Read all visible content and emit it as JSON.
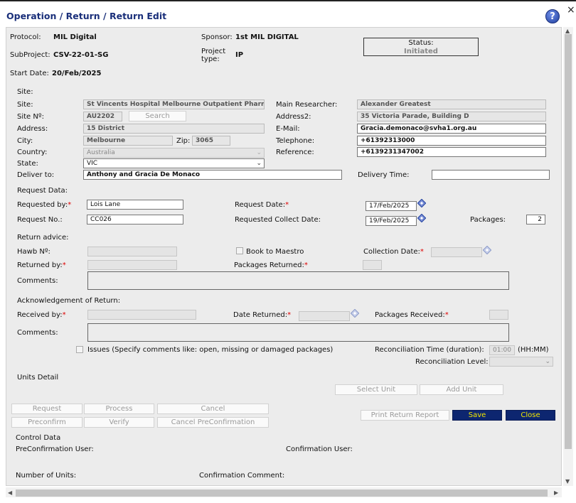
{
  "window": {
    "title": "Operation / Return / Return Edit",
    "close_glyph": "×",
    "help_glyph": "?"
  },
  "header": {
    "protocol_label": "Protocol:",
    "protocol": "MIL Digital",
    "sponsor_label": "Sponsor:",
    "sponsor": "1st MIL DIGITAL",
    "subproject_label": "SubProject:",
    "subproject": "CSV-22-01-SG",
    "project_type_label_1": "Project",
    "project_type_label_2": "type:",
    "project_type": "IP",
    "start_date_label": "Start Date:",
    "start_date": "20/Feb/2025",
    "status_label": "Status:",
    "status": "Initiated"
  },
  "site": {
    "section_label": "Site:",
    "site_label": "Site:",
    "site": "St Vincents Hospital Melbourne Outpatient Pharmacy",
    "site_no_label": "Site Nº:",
    "site_no": "AU2202",
    "search_label": "Search",
    "address_label": "Address:",
    "address": "15 District",
    "city_label": "City:",
    "city": "Melbourne",
    "zip_label": "Zip:",
    "zip": "3065",
    "country_label": "Country:",
    "country": "Australia",
    "state_label": "State:",
    "state": "VIC",
    "deliver_to_label": "Deliver to:",
    "deliver_to": "Anthony and Gracia De Monaco",
    "main_researcher_label": "Main Researcher:",
    "main_researcher": "Alexander Greatest",
    "address2_label": "Address2:",
    "address2": "35 Victoria Parade, Building D",
    "email_label": "E-Mail:",
    "email": "Gracia.demonaco@svha1.org.au",
    "telephone_label": "Telephone:",
    "telephone": "+61392313000",
    "reference_label": "Reference:",
    "reference": "+6139231347002",
    "delivery_time_label": "Delivery Time:",
    "delivery_time": ""
  },
  "request": {
    "section_label": "Request Data:",
    "requested_by_label": "Requested by:",
    "requested_by": "Lois Lane",
    "request_no_label": "Request No.:",
    "request_no": "CC026",
    "request_date_label": "Request Date:",
    "request_date": "17/Feb/2025",
    "collect_date_label": "Requested Collect Date:",
    "collect_date": "19/Feb/2025",
    "packages_label": "Packages:",
    "packages": "2"
  },
  "return_advice": {
    "section_label": "Return advice:",
    "hawb_label": "Hawb Nº:",
    "book_label": "Book to Maestro",
    "collection_date_label": "Collection Date:",
    "returned_by_label": "Returned by:",
    "packages_returned_label": "Packages Returned:",
    "comments_label": "Comments:"
  },
  "acknowledgement": {
    "section_label": "Acknowledgement of Return:",
    "received_by_label": "Received by:",
    "date_returned_label": "Date Returned:",
    "packages_received_label": "Packages Received:",
    "comments_label": "Comments:",
    "issues_label": "Issues (Specify comments like: open, missing or damaged packages)",
    "recon_time_label": "Reconciliation Time (duration):",
    "recon_time": "01:00",
    "recon_time_unit": "(HH:MM)",
    "recon_level_label": "Reconciliation Level:"
  },
  "units": {
    "section_label": "Units Detail",
    "select_unit": "Select Unit",
    "add_unit": "Add Unit"
  },
  "actions": {
    "request": "Request",
    "process": "Process",
    "cancel": "Cancel",
    "preconfirm": "Preconfirm",
    "verify": "Verify",
    "cancel_preconfirmation": "Cancel PreConfirmation",
    "print_report": "Print Return Report",
    "save": "Save",
    "close": "Close"
  },
  "control": {
    "section_label": "Control Data",
    "preconfirmation_user_label": "PreConfirmation User:",
    "confirmation_user_label": "Confirmation User:",
    "number_of_units_label": "Number of Units:",
    "confirmation_comment_label": "Confirmation Comment:"
  },
  "colors": {
    "title": "#1a2f7a",
    "primary_button_bg": "#0d2670",
    "primary_button_text": "#f2e600",
    "required": "#dd0000"
  }
}
